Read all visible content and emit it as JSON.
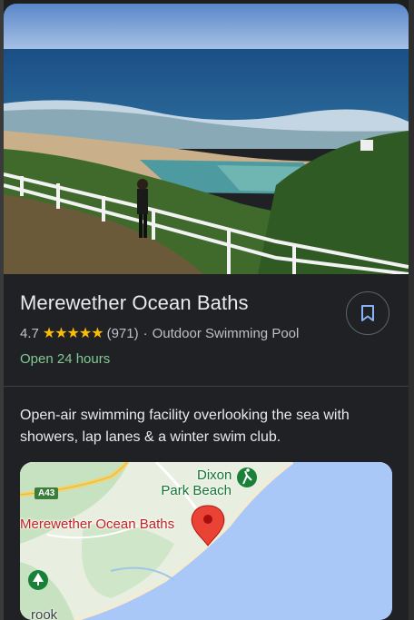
{
  "place": {
    "name": "Merewether Ocean Baths",
    "rating": "4.7",
    "stars": "★★★★★",
    "review_count": "(971)",
    "separator": "·",
    "category": "Outdoor Swimming Pool",
    "hours_status": "Open 24 hours",
    "description": "Open-air swimming facility overlooking the sea with showers, lap lanes & a winter swim club."
  },
  "map": {
    "pin_label": "Merewether Ocean Baths",
    "poi_label_line1": "Dixon",
    "poi_label_line2": "Park Beach",
    "road_shield": "A43",
    "partial_label": "rook"
  },
  "colors": {
    "background": "#202124",
    "star": "#fbbc04",
    "open_status": "#81c995",
    "pin": "#ea4335"
  },
  "icons": {
    "save": "bookmark-icon",
    "pin": "map-pin-icon",
    "poi": "hiking-icon",
    "tree": "tree-icon"
  }
}
